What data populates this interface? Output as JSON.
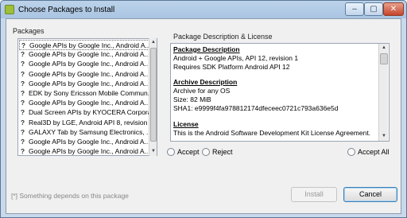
{
  "window": {
    "title": "Choose Packages to Install",
    "controls": {
      "minimize": "–",
      "maximize": "▢",
      "close": "✕"
    }
  },
  "packages": {
    "group_label": "Packages",
    "items": [
      {
        "icon": "question-icon",
        "label": "Google APIs by Google Inc., Android A..."
      },
      {
        "icon": "question-icon",
        "label": "Google APIs by Google Inc., Android A..."
      },
      {
        "icon": "question-icon",
        "label": "Google APIs by Google Inc., Android A..."
      },
      {
        "icon": "question-icon",
        "label": "Google APIs by Google Inc., Android A..."
      },
      {
        "icon": "question-icon",
        "label": "Google APIs by Google Inc., Android A..."
      },
      {
        "icon": "question-icon",
        "label": "EDK by Sony Ericsson Mobile Commun..."
      },
      {
        "icon": "question-icon",
        "label": "Google APIs by Google Inc., Android A..."
      },
      {
        "icon": "question-icon",
        "label": "Dual Screen APIs by KYOCERA Corpora..."
      },
      {
        "icon": "question-icon",
        "label": "Real3D by LGE, Android API 8, revision 1"
      },
      {
        "icon": "question-icon",
        "label": "GALAXY Tab by Samsung Electronics, ..."
      },
      {
        "icon": "question-icon",
        "label": "Google APIs by Google Inc., Android A..."
      },
      {
        "icon": "question-icon",
        "label": "Google APIs by Google Inc., Android A..."
      }
    ]
  },
  "description": {
    "group_label": "Package Description & License",
    "package_heading": "Package Description",
    "package_lines": [
      "Android + Google APIs, API 12, revision 1",
      "Requires SDK Platform Android API 12"
    ],
    "archive_heading": "Archive Description",
    "archive_lines": [
      "Archive for any OS",
      "Size: 82 MiB",
      "SHA1: e9999f4fa978812174dfeceec0721c793a636e5d"
    ],
    "license_heading": "License",
    "license_lines": [
      "This is the Android Software Development Kit License Agreement."
    ]
  },
  "choices": {
    "accept": "Accept",
    "reject": "Reject",
    "accept_all": "Accept All"
  },
  "footer": {
    "status": "[*] Something depends on this package",
    "install": "Install",
    "cancel": "Cancel"
  }
}
